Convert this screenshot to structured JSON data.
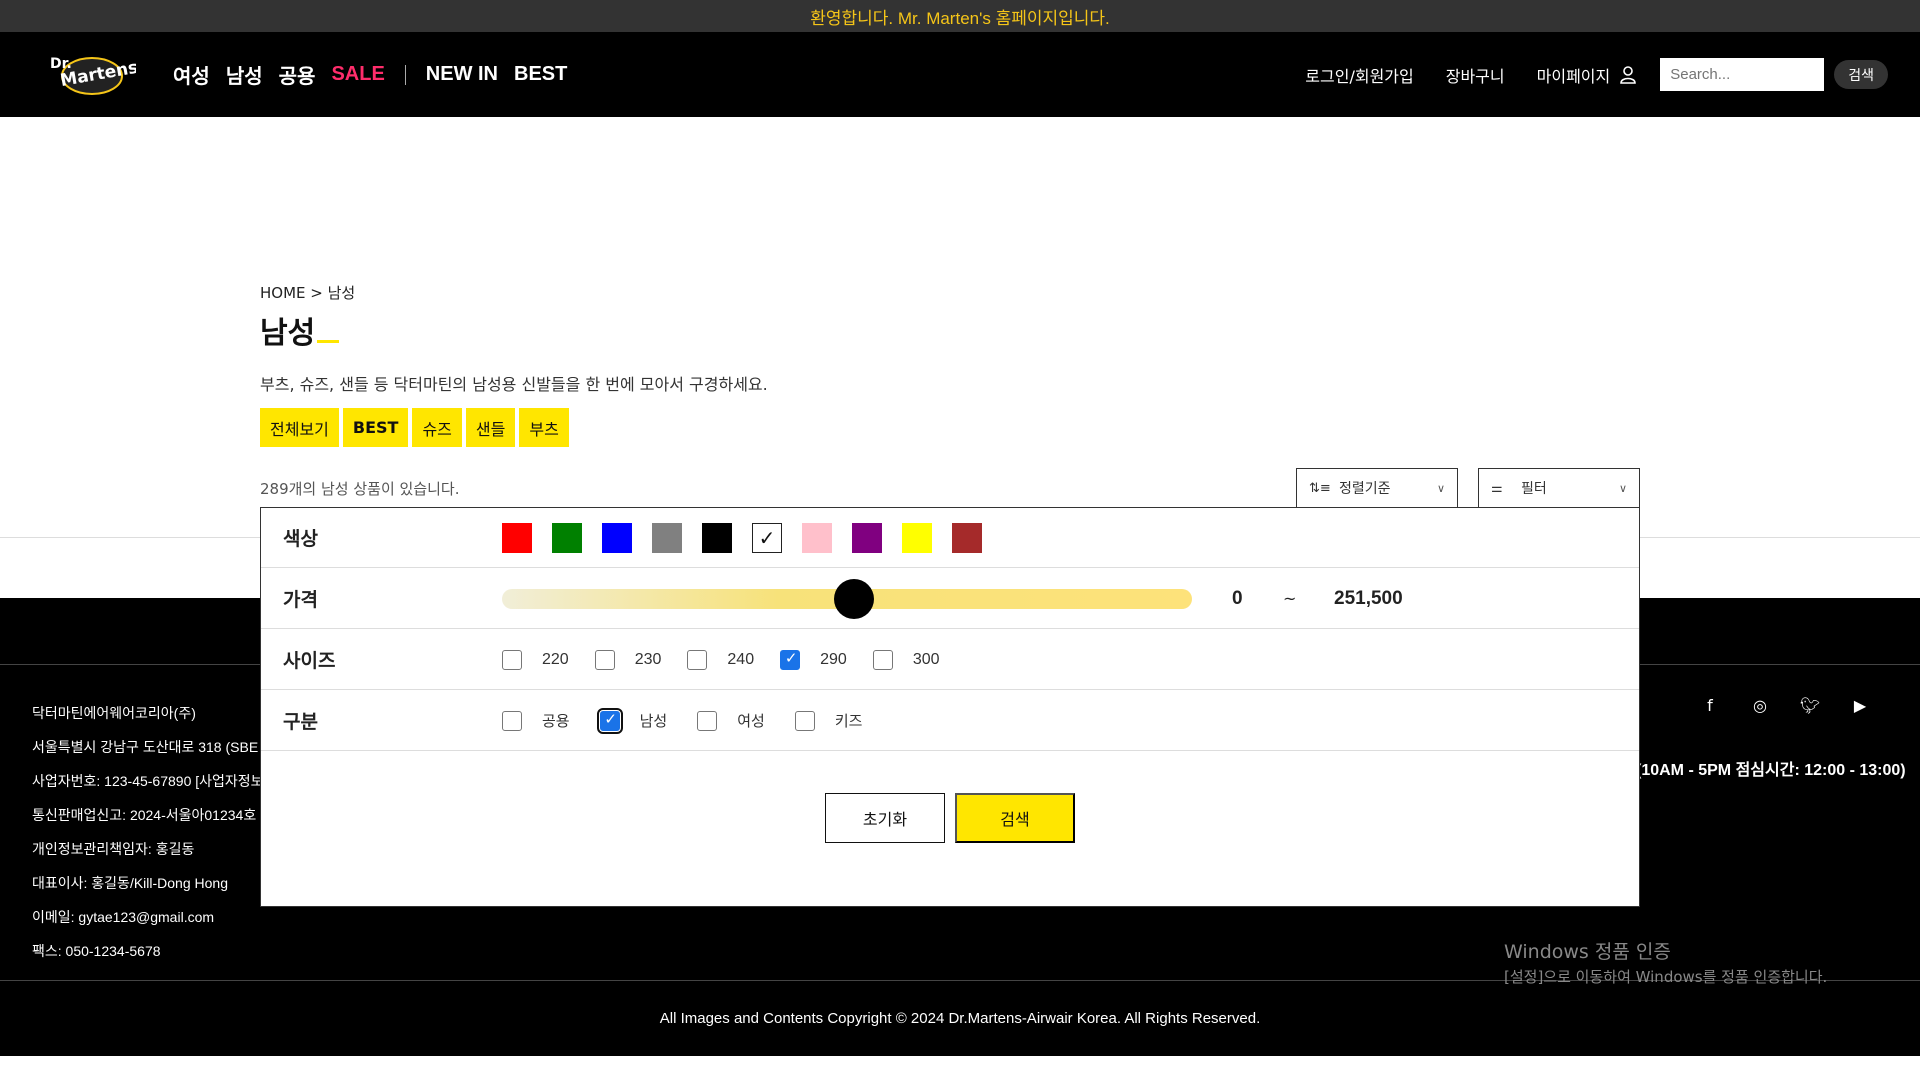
{
  "topbar": {
    "text": "환영합니다. Mr. Marten's 홈페이지입니다."
  },
  "header": {
    "logo_alt": "Dr. Martens",
    "nav": [
      "여성",
      "남성",
      "공용",
      "SALE",
      "NEW IN",
      "BEST"
    ],
    "links": {
      "login": "로그인/회원가입",
      "cart": "장바구니",
      "mypage": "마이페이지"
    },
    "search": {
      "placeholder": "Search...",
      "button": "검색"
    }
  },
  "page": {
    "breadcrumb": "HOME > 남성",
    "title": "남성",
    "description": "부츠, 슈즈, 샌들 등 닥터마틴의 남성용 신발들을 한 번에 모아서 구경하세요.",
    "categories": [
      "전체보기",
      "BEST",
      "슈즈",
      "샌들",
      "부츠"
    ],
    "count_text": "289개의 남성 상품이 있습니다.",
    "sort_label": "정렬기준",
    "filter_label": "필터"
  },
  "filter": {
    "color_label": "색상",
    "colors": [
      {
        "name": "red",
        "hex": "#ff0000",
        "selected": false
      },
      {
        "name": "green",
        "hex": "#008000",
        "selected": false
      },
      {
        "name": "blue",
        "hex": "#0000ff",
        "selected": false
      },
      {
        "name": "gray",
        "hex": "#808080",
        "selected": false
      },
      {
        "name": "black",
        "hex": "#000000",
        "selected": false
      },
      {
        "name": "white",
        "hex": "#ffffff",
        "selected": true
      },
      {
        "name": "pink",
        "hex": "#ffc0cb",
        "selected": false
      },
      {
        "name": "purple",
        "hex": "#800080",
        "selected": false
      },
      {
        "name": "yellow",
        "hex": "#ffff00",
        "selected": false
      },
      {
        "name": "brown",
        "hex": "#a52a2a",
        "selected": false
      }
    ],
    "price_label": "가격",
    "price_min": "0",
    "price_tilde": "~",
    "price_max": "251,500",
    "price_slider_fraction": 0.5,
    "size_label": "사이즈",
    "sizes": [
      {
        "label": "220",
        "checked": false
      },
      {
        "label": "230",
        "checked": false
      },
      {
        "label": "240",
        "checked": false
      },
      {
        "label": "290",
        "checked": true
      },
      {
        "label": "300",
        "checked": false
      }
    ],
    "gender_label": "구분",
    "genders": [
      {
        "label": "공용",
        "checked": false
      },
      {
        "label": "남성",
        "checked": true
      },
      {
        "label": "여성",
        "checked": false
      },
      {
        "label": "키즈",
        "checked": false
      }
    ],
    "reset_button": "초기화",
    "search_button": "검색"
  },
  "footer": {
    "info": [
      "닥터마틴에어웨어코리아(주)",
      "서울특별시 강남구 도산대로 318 (SBE",
      "사업자번호: 123-45-67890 [사업자정보",
      "통신판매업신고: 2024-서울아01234호",
      "개인정보관리책임자: 홍길동",
      "대표이사: 홍길동/Kill-Dong Hong",
      "이메일: gytae123@gmail.com",
      "팩스: 050-1234-5678"
    ],
    "hours": "(10AM - 5PM 점심시간: 12:00 - 13:00)",
    "copyright": "All Images and Contents Copyright © 2024 Dr.Martens-Airwair Korea. All Rights Reserved."
  },
  "watermark": {
    "line1": "Windows 정품 인증",
    "line2": "[설정]으로 이동하여 Windows를 정품 인증합니다."
  }
}
